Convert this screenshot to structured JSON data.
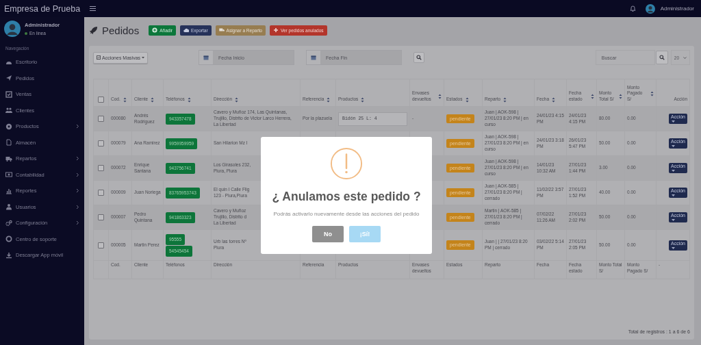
{
  "header": {
    "brand": "Empresa de Prueba",
    "user": "Administrador"
  },
  "sidebar": {
    "user": {
      "name": "Administrador",
      "status": "En línea",
      "online": true
    },
    "section": "Navegación",
    "items": [
      {
        "label": "Escritorio",
        "has_submenu": false
      },
      {
        "label": "Pedidos",
        "has_submenu": false
      },
      {
        "label": "Ventas",
        "has_submenu": false
      },
      {
        "label": "Clientes",
        "has_submenu": false
      },
      {
        "label": "Productos",
        "has_submenu": true
      },
      {
        "label": "Almacén",
        "has_submenu": false
      },
      {
        "label": "Repartos",
        "has_submenu": true
      },
      {
        "label": "Contabilidad",
        "has_submenu": true
      },
      {
        "label": "Reportes",
        "has_submenu": true
      },
      {
        "label": "Usuarios",
        "has_submenu": true
      },
      {
        "label": "Configuración",
        "has_submenu": true
      },
      {
        "label": "Centro de soporte",
        "has_submenu": false
      },
      {
        "label": "Descargar App móvil",
        "has_submenu": false
      }
    ]
  },
  "page": {
    "title": "Pedidos",
    "actions": [
      {
        "label": "Añadir",
        "kind": "success",
        "disabled": false
      },
      {
        "label": "Exportar",
        "kind": "primary",
        "disabled": false
      },
      {
        "label": "Asignar a Reparto",
        "kind": "warning",
        "disabled": true
      },
      {
        "label": "Ver pedidos anulados",
        "kind": "danger",
        "disabled": false
      }
    ]
  },
  "filters": {
    "bulk_actions": "Acciones Masivas",
    "start_date": {
      "placeholder": "Fecha Inicio"
    },
    "end_date": {
      "placeholder": "Fecha Fin"
    },
    "search": {
      "placeholder": "Buscar"
    },
    "page_size": "20"
  },
  "table": {
    "select_all": {
      "checked": false
    },
    "columns": [
      {
        "label": "Cod.",
        "sortable": true
      },
      {
        "label": "Cliente",
        "sortable": true
      },
      {
        "label": "Teléfonos",
        "sortable": true
      },
      {
        "label": "Dirección",
        "sortable": true
      },
      {
        "label": "Referencia",
        "sortable": true
      },
      {
        "label": "Productos",
        "sortable": true
      },
      {
        "label": "Envases devueltos",
        "sortable": true
      },
      {
        "label": "Estados",
        "sortable": true
      },
      {
        "label": "Reparto",
        "sortable": true
      },
      {
        "label": "Fecha",
        "sortable": true
      },
      {
        "label": "Fecha estado",
        "sortable": true
      },
      {
        "label": "Monto Total S/",
        "sortable": true
      },
      {
        "label": "Monto Pagado S/",
        "sortable": true
      },
      {
        "label": "Acción",
        "sortable": false
      }
    ],
    "rows": [
      {
        "checked": false,
        "cod": "000080",
        "cliente": "Andrés Rodriguez",
        "telefonos": [
          "943357478"
        ],
        "direccion": [
          "Cavero y Muñoz 174, Las Quintanas,",
          "Trujillo, Distrito de Victor Larco Herrera,",
          "La Libertad"
        ],
        "referencia": "Por la plazuela",
        "productos": "Bidón 25 L: 4",
        "envases": "-",
        "estado": "pendiente",
        "reparto": "Juan | AOK-598 | 27/01/23 8:20 PM | en curso",
        "fecha": "24/01/23 4:15 PM",
        "fecha_estado": "24/01/23 4:15 PM",
        "monto_total": "80.00",
        "monto_pagado": "0.00",
        "action": "Acción"
      },
      {
        "checked": false,
        "cod": "000079",
        "cliente": "Ana Ramirez",
        "telefonos": [
          "9959959959"
        ],
        "direccion": [
          "San Hilarion Mz I"
        ],
        "estado": "pendiente",
        "reparto": "Juan | AOK-598 | 27/01/23 8:20 PM | en curso",
        "fecha": "24/01/23 3:18 PM",
        "fecha_estado": "26/01/23 5:47 PM",
        "monto_total": "50.00",
        "monto_pagado": "0.00",
        "action": "Acción"
      },
      {
        "checked": false,
        "cod": "000072",
        "cliente": "Enrique Santana",
        "telefonos": [
          "943756741"
        ],
        "direccion": [
          "Los Girasoles 232,",
          "Piura, Piura"
        ],
        "estado": "pendiente",
        "reparto": "Juan | AOK-598 | 27/01/23 8:20 PM | en curso",
        "fecha": "14/01/23 10:32 AM",
        "fecha_estado": "27/01/23 1:44 PM",
        "monto_total": "3.00",
        "monto_pagado": "0.00",
        "action": "Acción"
      },
      {
        "checked": false,
        "cod": "000009",
        "cliente": "Juan Noriega",
        "telefonos": [
          "83765953743"
        ],
        "direccion": [
          "El quin I Calle Flig",
          "123 - Piura,Piura"
        ],
        "estado": "pendiente",
        "reparto": "Juan | AOK-585 | 27/01/23 8:20 PM | cerrado",
        "fecha": "11/02/22 3:57 PM",
        "fecha_estado": "27/01/23 1:52 PM",
        "monto_total": "40.00",
        "monto_pagado": "0.00",
        "action": "Acción"
      },
      {
        "checked": false,
        "cod": "000007",
        "cliente": "Pedro Quintana",
        "telefonos": [
          "941863323"
        ],
        "direccion": [
          "Cavero y Muñoz",
          "Trujillo, Distrito d",
          "La Libertad"
        ],
        "estado": "pendiente",
        "reparto": "Martin | AOK-585 | 27/01/23 8:20 PM | cerrado",
        "fecha": "07/02/22 11:26 AM",
        "fecha_estado": "27/01/23 2:02 PM",
        "monto_total": "50.00",
        "monto_pagado": "0.00",
        "action": "Acción"
      },
      {
        "checked": false,
        "cod": "000005",
        "cliente": "Martin Perez",
        "telefonos": [
          "95555",
          "54545454"
        ],
        "direccion": [
          "Urb las torres Nº",
          "Piura"
        ],
        "estado": "pendiente",
        "reparto": "Juan | | 27/01/23 8:20 PM | cerrado",
        "fecha": "03/02/22 5:14 PM",
        "fecha_estado": "27/01/23 2:05 PM",
        "monto_total": "50.00",
        "monto_pagado": "0.00",
        "action": "Acción"
      }
    ],
    "footer": [
      "Cod.",
      "Cliente",
      "Teléfonos",
      "Dirección",
      "Referencia",
      "Productos",
      "Envases devueltos",
      "Estados",
      "Reparto",
      "Fecha",
      "Fecha estado",
      "Monto Total S/",
      "Monto Pagado S/",
      "-"
    ]
  },
  "status_bar": "Total de registros : 1 a 6 de 6",
  "dialog": {
    "title": "¿ Anulamos este pedido ?",
    "message": "Podrás activarlo nuevamente desde las acciones del pedido",
    "buttons": [
      {
        "label": "No",
        "kind": "cancel"
      },
      {
        "label": "¡Sí!",
        "kind": "confirm"
      }
    ]
  }
}
